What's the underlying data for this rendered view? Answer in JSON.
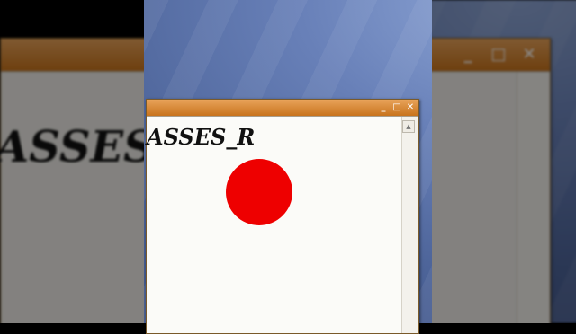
{
  "editor": {
    "text": "ASSES_R",
    "text_background": "ASSES"
  },
  "titlebar": {
    "minimize": "_",
    "maximize": "□",
    "close": "✕"
  },
  "scrollbar": {
    "up_arrow": "▲"
  },
  "colors": {
    "titlebar": "#d88a3a",
    "desktop": "#5a72aa",
    "click_indicator": "#ee0000"
  }
}
